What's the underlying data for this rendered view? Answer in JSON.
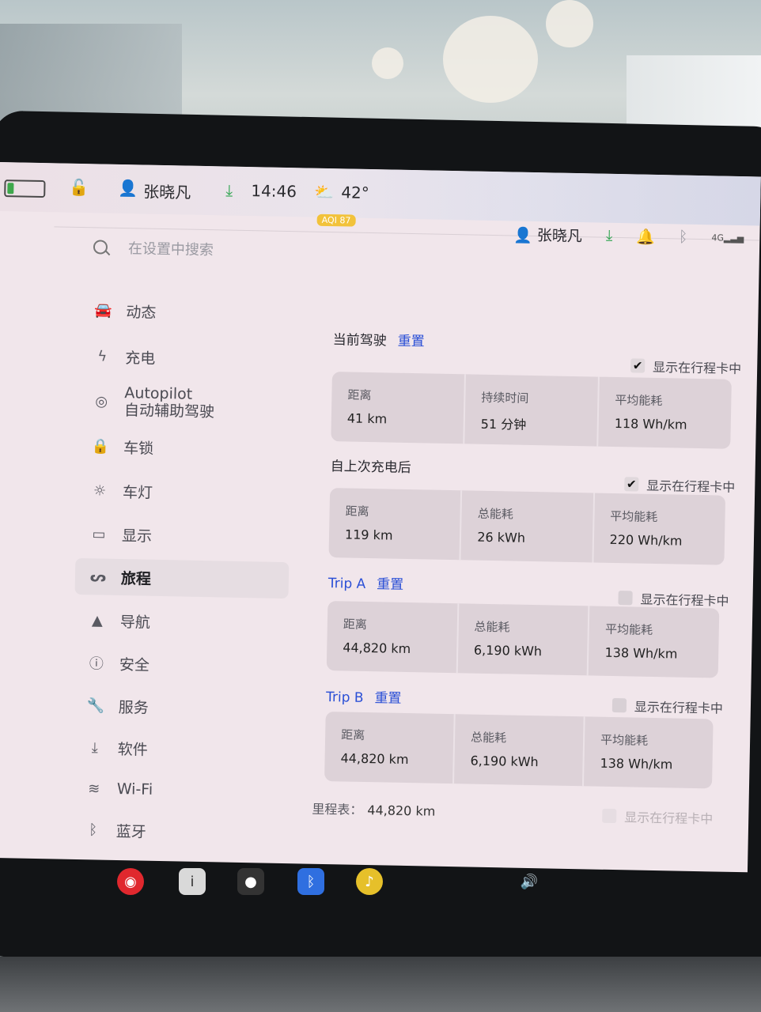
{
  "status_bar": {
    "user_name": "张晓凡",
    "time": "14:46",
    "temperature": "42°",
    "aqi_label": "AQI 87"
  },
  "search": {
    "placeholder": "在设置中搜索"
  },
  "header_user": {
    "name": "张晓凡",
    "signal_label": "4G"
  },
  "sidebar": {
    "items": [
      {
        "label": "动态",
        "icon": "car-icon"
      },
      {
        "label": "充电",
        "icon": "bolt-icon"
      },
      {
        "label": "Autopilot",
        "label2": "自动辅助驾驶",
        "icon": "steering-wheel-icon"
      },
      {
        "label": "车锁",
        "icon": "lock-icon"
      },
      {
        "label": "车灯",
        "icon": "sun-icon"
      },
      {
        "label": "显示",
        "icon": "display-icon"
      },
      {
        "label": "旅程",
        "icon": "trips-icon",
        "active": true
      },
      {
        "label": "导航",
        "icon": "navigation-arrow-icon"
      },
      {
        "label": "安全",
        "icon": "alert-circle-icon"
      },
      {
        "label": "服务",
        "icon": "wrench-icon"
      },
      {
        "label": "软件",
        "icon": "download-icon"
      },
      {
        "label": "Wi-Fi",
        "icon": "wifi-icon"
      },
      {
        "label": "蓝牙",
        "icon": "bluetooth-icon"
      }
    ]
  },
  "trips": {
    "current": {
      "title": "当前驾驶",
      "reset": "重置",
      "show_label": "显示在行程卡中",
      "show_checked": true,
      "cells": [
        {
          "k": "距离",
          "v": "41 km"
        },
        {
          "k": "持续时间",
          "v": "51 分钟"
        },
        {
          "k": "平均能耗",
          "v": "118 Wh/km"
        }
      ]
    },
    "since_charge": {
      "title": "自上次充电后",
      "show_label": "显示在行程卡中",
      "show_checked": true,
      "cells": [
        {
          "k": "距离",
          "v": "119 km"
        },
        {
          "k": "总能耗",
          "v": "26 kWh"
        },
        {
          "k": "平均能耗",
          "v": "220 Wh/km"
        }
      ]
    },
    "trip_a": {
      "title": "Trip A",
      "reset": "重置",
      "show_label": "显示在行程卡中",
      "show_checked": false,
      "cells": [
        {
          "k": "距离",
          "v": "44,820 km"
        },
        {
          "k": "总能耗",
          "v": "6,190 kWh"
        },
        {
          "k": "平均能耗",
          "v": "138 Wh/km"
        }
      ]
    },
    "trip_b": {
      "title": "Trip B",
      "reset": "重置",
      "show_label": "显示在行程卡中",
      "show_checked": false,
      "cells": [
        {
          "k": "距离",
          "v": "44,820 km"
        },
        {
          "k": "总能耗",
          "v": "6,190 kWh"
        },
        {
          "k": "平均能耗",
          "v": "138 Wh/km"
        }
      ]
    },
    "odometer": {
      "label": "里程表：",
      "value": "44,820 km",
      "show_label": "显示在行程卡中"
    }
  },
  "colors": {
    "accent": "#2a4fd6",
    "active_bg": "#e6dde2",
    "screen_bg": "#f1e6eb"
  }
}
